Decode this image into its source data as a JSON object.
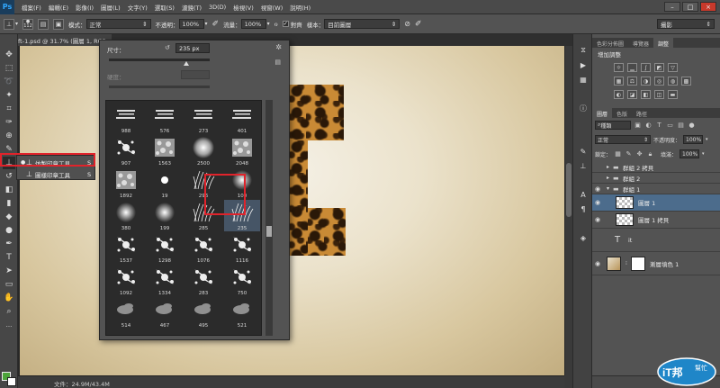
{
  "menu": {
    "logo": "Ps",
    "items": [
      "檔案(F)",
      "編輯(E)",
      "影像(I)",
      "圖層(L)",
      "文字(Y)",
      "選取(S)",
      "濾鏡(T)",
      "3D(D)",
      "檢視(V)",
      "視窗(W)",
      "說明(H)"
    ],
    "minimize": "–",
    "restore": "□",
    "close": "×"
  },
  "options_bar": {
    "brush_size": "112",
    "mode_label": "模式：",
    "mode_value": "正常",
    "opacity_label": "不透明：",
    "opacity_value": "100%",
    "flow_label": "流量：",
    "flow_value": "100%",
    "aligned_label": "對齊",
    "sample_label": "樣本：",
    "sample_value": "目前圖層",
    "workspace_value": "攝影"
  },
  "document": {
    "tab_title": "ft-1.psd @ 31.7% (圖層 1, RGB",
    "status": "文件：24.9M/43.4M"
  },
  "tool_flyout": {
    "items": [
      {
        "label": "仿製印章工具",
        "shortcut": "S",
        "active": true
      },
      {
        "label": "圖樣印章工具",
        "shortcut": "S",
        "active": false
      }
    ]
  },
  "brush_panel": {
    "size_label": "尺寸：",
    "size_value": "235 px",
    "hardness_label": "硬度：",
    "brushes": [
      {
        "num": "988",
        "kind": "dry",
        "selected": false
      },
      {
        "num": "576",
        "kind": "dry",
        "selected": false
      },
      {
        "num": "273",
        "kind": "dry",
        "selected": false
      },
      {
        "num": "401",
        "kind": "dry",
        "selected": false
      },
      {
        "num": "907",
        "kind": "splat",
        "selected": false
      },
      {
        "num": "1563",
        "kind": "texture",
        "selected": false
      },
      {
        "num": "2500",
        "kind": "soft-big",
        "selected": false
      },
      {
        "num": "2048",
        "kind": "texture",
        "selected": false
      },
      {
        "num": "1892",
        "kind": "texture",
        "selected": false
      },
      {
        "num": "19",
        "kind": "hard",
        "selected": false
      },
      {
        "num": "296",
        "kind": "grass",
        "selected": false
      },
      {
        "num": "100",
        "kind": "soft",
        "selected": false
      },
      {
        "num": "380",
        "kind": "soft",
        "selected": false
      },
      {
        "num": "199",
        "kind": "soft",
        "selected": false
      },
      {
        "num": "285",
        "kind": "grass",
        "selected": false
      },
      {
        "num": "235",
        "kind": "grass",
        "selected": true
      },
      {
        "num": "1537",
        "kind": "splat",
        "selected": false
      },
      {
        "num": "1298",
        "kind": "splat",
        "selected": false
      },
      {
        "num": "1076",
        "kind": "splat",
        "selected": false
      },
      {
        "num": "1116",
        "kind": "splat",
        "selected": false
      },
      {
        "num": "1092",
        "kind": "splat",
        "selected": false
      },
      {
        "num": "1334",
        "kind": "splat",
        "selected": false
      },
      {
        "num": "283",
        "kind": "splat",
        "selected": false
      },
      {
        "num": "750",
        "kind": "splat",
        "selected": false
      },
      {
        "num": "514",
        "kind": "smoke",
        "selected": false
      },
      {
        "num": "467",
        "kind": "smoke",
        "selected": false
      },
      {
        "num": "495",
        "kind": "smoke",
        "selected": false
      },
      {
        "num": "521",
        "kind": "smoke",
        "selected": false
      },
      {
        "num": "",
        "kind": "smoke",
        "selected": false
      },
      {
        "num": "",
        "kind": "smoke",
        "selected": false
      },
      {
        "num": "",
        "kind": "smoke",
        "selected": false
      },
      {
        "num": "",
        "kind": "smoke",
        "selected": false
      }
    ]
  },
  "right_panels": {
    "top_tabs": [
      "色彩分佈圖",
      "導覽器",
      "調整"
    ],
    "adjust_title": "增加調整",
    "layer_tabs": [
      "圖層",
      "色版",
      "路徑"
    ],
    "filter_value": "種類",
    "blend_value": "正常",
    "opacity_label": "不透明度：",
    "opacity_value": "100%",
    "lock_label": "鎖定：",
    "fill_label": "填滿：",
    "fill_value": "100%",
    "layers": [
      {
        "name": "群組 2 拷貝",
        "type": "group",
        "expanded": false,
        "indent": 0,
        "active": false,
        "eye": false
      },
      {
        "name": "群組 2",
        "type": "group",
        "expanded": false,
        "indent": 0,
        "active": false,
        "eye": false
      },
      {
        "name": "群組 1",
        "type": "group",
        "expanded": true,
        "indent": 0,
        "active": false,
        "eye": true
      },
      {
        "name": "圖層 1",
        "type": "pixel",
        "expanded": false,
        "indent": 1,
        "active": true,
        "eye": true
      },
      {
        "name": "圖層 1 拷貝",
        "type": "pixel",
        "expanded": false,
        "indent": 1,
        "active": false,
        "eye": true
      },
      {
        "name": "it",
        "type": "text",
        "expanded": false,
        "indent": 0,
        "active": false,
        "eye": false
      },
      {
        "name": "漸層填色 1",
        "type": "gradient",
        "expanded": false,
        "indent": 0,
        "active": false,
        "eye": true
      }
    ]
  },
  "watermark": {
    "main": "iT邦",
    "sub": "幫忙"
  }
}
